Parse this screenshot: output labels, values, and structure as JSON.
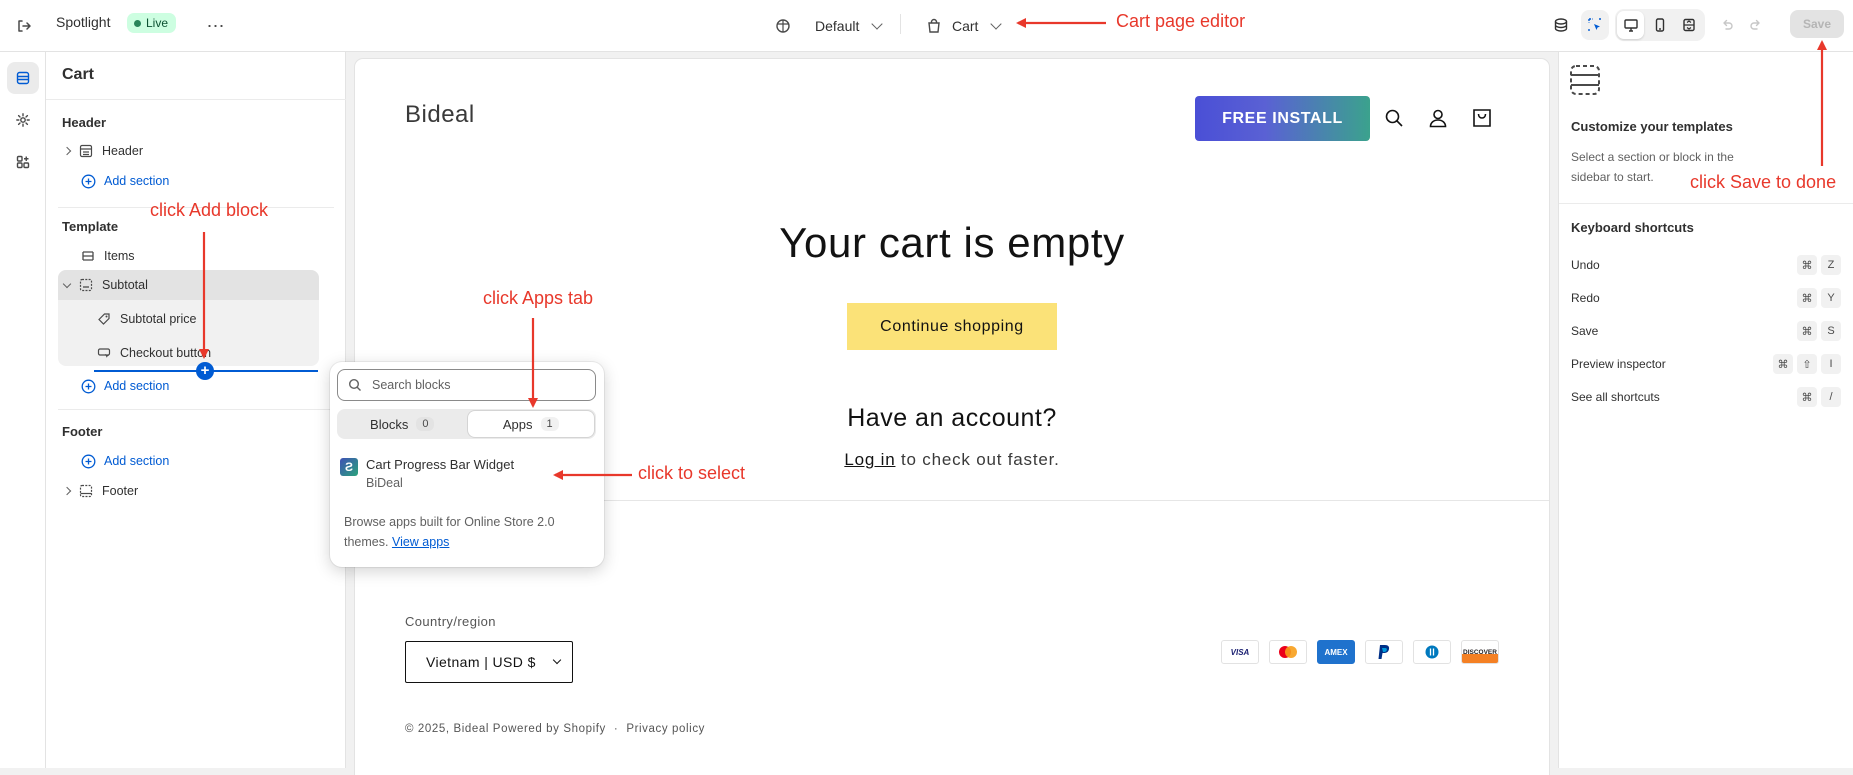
{
  "topbar": {
    "store_name": "Spotlight",
    "status_badge": "Live",
    "more_label": "⋯",
    "theme_select": "Default",
    "page_select": "Cart",
    "save_label": "Save"
  },
  "sidebar": {
    "title": "Cart",
    "groups": {
      "header": {
        "label": "Header",
        "section": "Header",
        "add": "Add section"
      },
      "template": {
        "label": "Template",
        "items": "Items",
        "subtotal": "Subtotal",
        "subtotal_price": "Subtotal price",
        "checkout_button": "Checkout button",
        "add": "Add section"
      },
      "footer": {
        "label": "Footer",
        "add": "Add section",
        "section": "Footer"
      }
    }
  },
  "preview": {
    "logo": "Bideal",
    "cta": "FREE INSTALL",
    "empty_title": "Your cart is empty",
    "continue": "Continue shopping",
    "account_title": "Have an account?",
    "login_link": "Log in",
    "login_suffix": " to check out faster.",
    "country_label": "Country/region",
    "country_value": "Vietnam | USD $",
    "payments": [
      "VISA",
      "MC",
      "AMEX",
      "PayPal",
      "D",
      "DISCOVER"
    ],
    "copyright": "© 2025, Bideal Powered by Shopify",
    "separator": "·",
    "privacy": "Privacy policy"
  },
  "right_panel": {
    "title": "Customize your templates",
    "description": "Select a section or block in the sidebar to start.",
    "shortcuts_title": "Keyboard shortcuts",
    "shortcuts": [
      {
        "label": "Undo",
        "keys": [
          "⌘",
          "Z"
        ]
      },
      {
        "label": "Redo",
        "keys": [
          "⌘",
          "Y"
        ]
      },
      {
        "label": "Save",
        "keys": [
          "⌘",
          "S"
        ]
      },
      {
        "label": "Preview inspector",
        "keys": [
          "⌘",
          "⇧",
          "I"
        ]
      },
      {
        "label": "See all shortcuts",
        "keys": [
          "⌘",
          "/"
        ]
      }
    ]
  },
  "popover": {
    "search_placeholder": "Search blocks",
    "tab_blocks": "Blocks",
    "tab_blocks_count": "0",
    "tab_apps": "Apps",
    "tab_apps_count": "1",
    "app_name": "Cart Progress Bar Widget",
    "app_developer": "BiDeal",
    "footer_text": "Browse apps built for Online Store 2.0 themes.",
    "footer_link": "View apps"
  },
  "annotations": {
    "cart_editor": "Cart page editor",
    "add_block": "click Add block",
    "apps_tab": "click Apps tab",
    "select": "click to select",
    "save": "click Save to done"
  },
  "colors": {
    "accent": "#005bd3",
    "annotation": "#e8382b",
    "live_badge": "#cdfee1",
    "continue_button": "#fbe278"
  }
}
